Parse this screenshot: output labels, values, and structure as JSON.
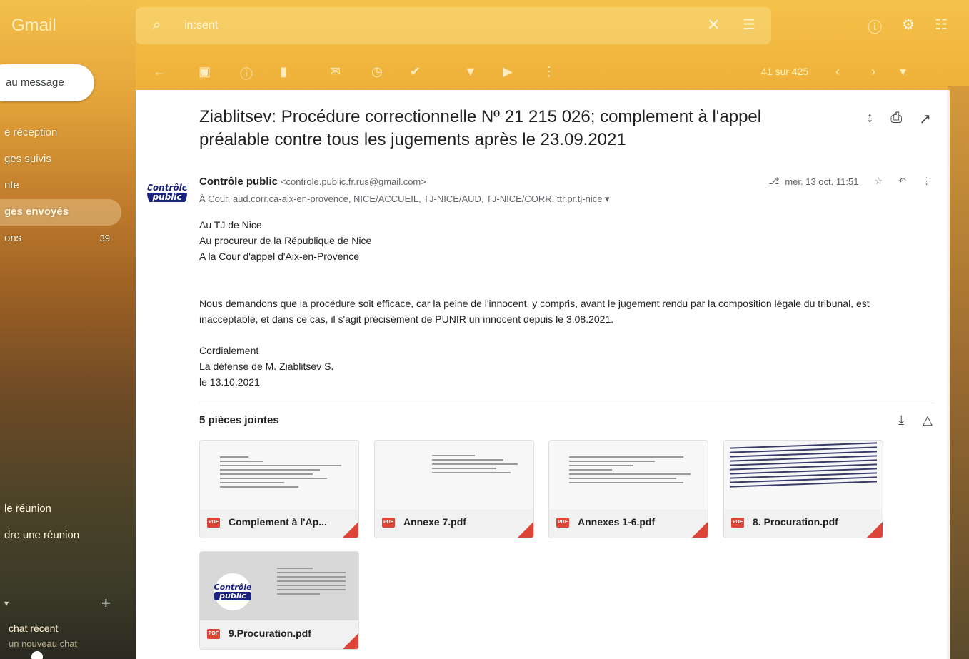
{
  "app": {
    "logo": "Gmail"
  },
  "search": {
    "query": "in:sent"
  },
  "toolbar": {
    "count": "41 sur 425"
  },
  "compose": {
    "label": "au message"
  },
  "sidebar": {
    "items": [
      {
        "label": "e réception",
        "count": ""
      },
      {
        "label": "ges suivis",
        "count": ""
      },
      {
        "label": "nte",
        "count": ""
      },
      {
        "label": "ges envoyés",
        "count": ""
      },
      {
        "label": "ons",
        "count": "39"
      }
    ],
    "meet": [
      "le réunion",
      "dre une réunion"
    ],
    "chat_recent": "chat récent",
    "chat_new": "un nouveau chat"
  },
  "email": {
    "subject": "Ziablitsev: Procédure correctionnelle Nº 21 215 026; complement à l'appel préalable contre tous les jugements après le 23.09.2021",
    "sender_name": "Contrôle public",
    "sender_email": "<controle.public.fr.rus@gmail.com>",
    "avatar_text_1": "Contrôle",
    "avatar_text_2": "public",
    "to": "À Cour, aud.corr.ca-aix-en-provence, NICE/ACCUEIL, TJ-NICE/AUD, TJ-NICE/CORR, ttr.pr.tj-nice",
    "date": "mer. 13 oct. 11:51",
    "body": {
      "line1": "Au TJ de Nice",
      "line2": "Au procureur de la République de Nice",
      "line3": "A la Cour d'appel d'Aix-en-Provence",
      "para": "Nous demandons que la procédure soit efficace, car la peine de l'innocent, y compris, avant le jugement rendu par la composition légale du tribunal, est inacceptable, et dans ce cas, il s'agit précisément de PUNIR un innocent depuis le 3.08.2021.",
      "sig1": "Cordialement",
      "sig2": "La défense de M. Ziablitsev S.",
      "sig3": "le 13.10.2021"
    }
  },
  "attachments": {
    "title": "5 pièces jointes",
    "files": [
      {
        "name": "Complement à l'Ap..."
      },
      {
        "name": "Annexe 7.pdf"
      },
      {
        "name": "Annexes 1-6.pdf"
      },
      {
        "name": "8. Procuration.pdf"
      },
      {
        "name": "9.Procuration.pdf"
      }
    ],
    "pdf_badge": "PDF"
  },
  "colors": {
    "accent": "#db4437",
    "brand_bg": "#f0b23a"
  }
}
